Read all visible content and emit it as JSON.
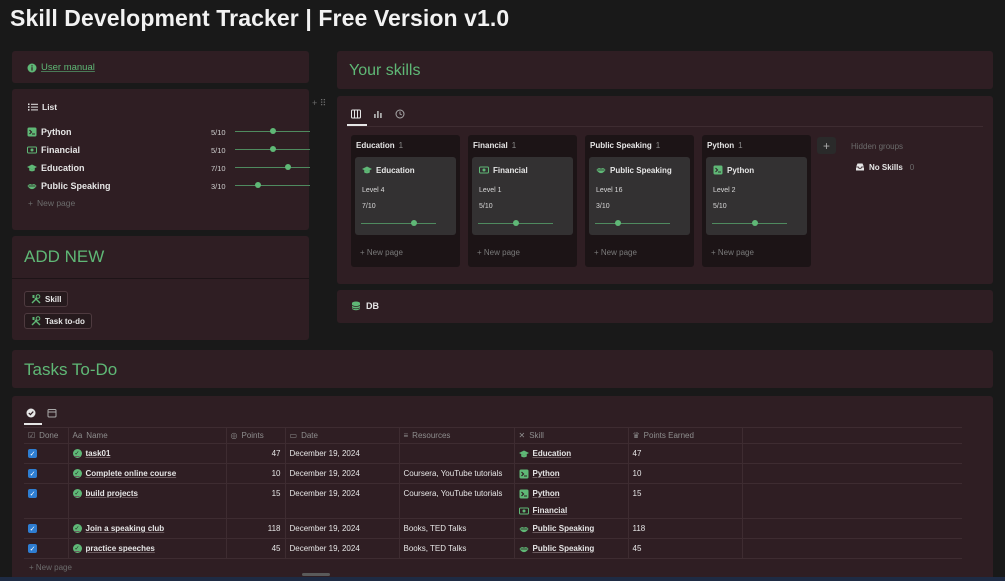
{
  "page_title": "Skill Development Tracker | Free Version v1.0",
  "user_manual": {
    "label": "User manual",
    "icon": "info-icon"
  },
  "list": {
    "title": "List",
    "items": [
      {
        "name": "Python",
        "score": "5/10",
        "level": 0.5,
        "icon": "python-icon"
      },
      {
        "name": "Financial",
        "score": "5/10",
        "level": 0.5,
        "icon": "money-icon"
      },
      {
        "name": "Education",
        "score": "7/10",
        "level": 0.7,
        "icon": "graduation-cap-icon"
      },
      {
        "name": "Public Speaking",
        "score": "3/10",
        "level": 0.3,
        "icon": "lips-icon"
      }
    ],
    "new_page": "New page"
  },
  "add_new": {
    "title": "ADD NEW",
    "buttons": [
      {
        "label": "Skill",
        "icon": "tools-icon"
      },
      {
        "label": "Task to-do",
        "icon": "tools-icon"
      }
    ]
  },
  "skills": {
    "title": "Your skills",
    "columns": [
      {
        "group": "Education",
        "count": "1",
        "card_title": "Education",
        "level": "Level 4",
        "score": "7/10",
        "value": 0.7,
        "icon": "graduation-cap-icon",
        "new_page": "New page"
      },
      {
        "group": "Financial",
        "count": "1",
        "card_title": "Financial",
        "level": "Level 1",
        "score": "5/10",
        "value": 0.5,
        "icon": "money-icon",
        "new_page": "New page"
      },
      {
        "group": "Public Speaking",
        "count": "1",
        "card_title": "Public Speaking",
        "level": "Level 16",
        "score": "3/10",
        "value": 0.3,
        "icon": "lips-icon",
        "new_page": "New page"
      },
      {
        "group": "Python",
        "count": "1",
        "card_title": "Python",
        "level": "Level 2",
        "score": "5/10",
        "value": 0.5,
        "icon": "python-icon",
        "new_page": "New page"
      }
    ],
    "hidden_groups": "Hidden groups",
    "no_skills": "No Skills",
    "no_skills_count": "0"
  },
  "db": {
    "label": "DB"
  },
  "tasks": {
    "title": "Tasks To-Do",
    "headers": {
      "done": "Done",
      "name": "Name",
      "points": "Points",
      "date": "Date",
      "resources": "Resources",
      "skill": "Skill",
      "earned": "Points Earned"
    },
    "rows": [
      {
        "name": "task01",
        "points": "47",
        "date": "December 19, 2024",
        "resources": "",
        "skills": [
          "Education"
        ],
        "earned": "47"
      },
      {
        "name": "Complete online course",
        "points": "10",
        "date": "December 19, 2024",
        "resources": "Coursera, YouTube tutorials",
        "skills": [
          "Python"
        ],
        "earned": "10"
      },
      {
        "name": "build projects",
        "points": "15",
        "date": "December 19, 2024",
        "resources": "Coursera, YouTube tutorials",
        "skills": [
          "Python",
          "Financial"
        ],
        "earned": "15"
      },
      {
        "name": "Join a speaking club",
        "points": "118",
        "date": "December 19, 2024",
        "resources": "Books, TED Talks",
        "skills": [
          "Public Speaking"
        ],
        "earned": "118"
      },
      {
        "name": "practice speeches",
        "points": "45",
        "date": "December 19, 2024",
        "resources": "Books, TED Talks",
        "skills": [
          "Public Speaking"
        ],
        "earned": "45"
      }
    ],
    "new_page": "New page"
  },
  "colors": {
    "accent": "#5fb876",
    "panel": "#2f1e23",
    "background": "#191919",
    "checkbox": "#2e7dd1"
  }
}
